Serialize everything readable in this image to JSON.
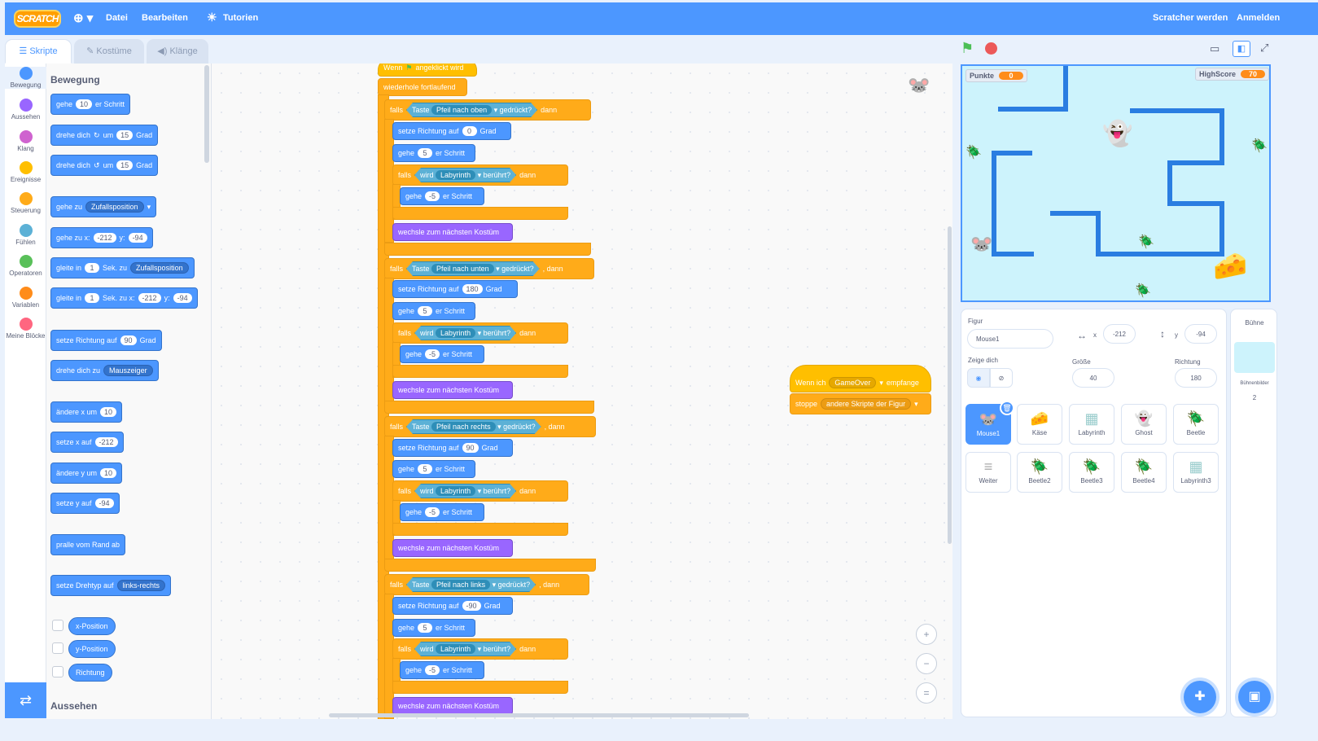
{
  "menubar": {
    "logo": "SCRATCH",
    "globe_icon": "globe-icon",
    "file": "Datei",
    "edit": "Bearbeiten",
    "tutorials": "Tutorien",
    "join": "Scratcher werden",
    "signin": "Anmelden"
  },
  "tabs": {
    "code": "Skripte",
    "costumes": "Kostüme",
    "sounds": "Klänge"
  },
  "categories": [
    {
      "label": "Bewegung",
      "color": "#4c97ff"
    },
    {
      "label": "Aussehen",
      "color": "#9966ff"
    },
    {
      "label": "Klang",
      "color": "#cf63cf"
    },
    {
      "label": "Ereignisse",
      "color": "#ffbf00"
    },
    {
      "label": "Steuerung",
      "color": "#ffab19"
    },
    {
      "label": "Fühlen",
      "color": "#5cb1d6"
    },
    {
      "label": "Operatoren",
      "color": "#59c059"
    },
    {
      "label": "Variablen",
      "color": "#ff8c1a"
    },
    {
      "label": "Meine Blöcke",
      "color": "#ff6680"
    }
  ],
  "palette": {
    "heading_motion": "Bewegung",
    "heading_looks": "Aussehen",
    "b1": {
      "a": "gehe",
      "v": "10",
      "b": "er Schritt"
    },
    "b2": {
      "a": "drehe dich",
      "b": "um",
      "v": "15",
      "c": "Grad"
    },
    "b3": {
      "a": "drehe dich",
      "b": "um",
      "v": "15",
      "c": "Grad"
    },
    "b4": {
      "a": "gehe zu",
      "d": "Zufallsposition"
    },
    "b5": {
      "a": "gehe zu x:",
      "x": "-212",
      "b": "y:",
      "y": "-94"
    },
    "b6": {
      "a": "gleite in",
      "v": "1",
      "b": "Sek. zu",
      "d": "Zufallsposition"
    },
    "b7": {
      "a": "gleite in",
      "v": "1",
      "b": "Sek. zu x:",
      "x": "-212",
      "c": "y:",
      "y": "-94"
    },
    "b8": {
      "a": "setze Richtung auf",
      "v": "90",
      "b": "Grad"
    },
    "b9": {
      "a": "drehe dich zu",
      "d": "Mauszeiger"
    },
    "b10": {
      "a": "ändere x um",
      "v": "10"
    },
    "b11": {
      "a": "setze x auf",
      "v": "-212"
    },
    "b12": {
      "a": "ändere y um",
      "v": "10"
    },
    "b13": {
      "a": "setze y auf",
      "v": "-94"
    },
    "b14": {
      "a": "pralle vom Rand ab"
    },
    "b15": {
      "a": "setze Drehtyp auf",
      "d": "links-rechts"
    },
    "r1": "x-Position",
    "r2": "y-Position",
    "r3": "Richtung"
  },
  "script": {
    "hat": {
      "a": "Wenn",
      "b": "angeklickt wird"
    },
    "forever": "wiederhole fortlaufend",
    "if": "falls",
    "then": "dann",
    "then2": ", dann",
    "key": "Taste",
    "pressed": "gedrückt?",
    "touching_a": "wird",
    "touching_d": "Labyrinth",
    "touching_b": "berührt?",
    "point": "setze Richtung auf",
    "deg": "Grad",
    "move": "gehe",
    "steps": "er Schritt",
    "step_val": "5",
    "back_val": "-5",
    "next_costume": "wechsle zum nächsten Kostüm",
    "k1": "Pfeil nach oben",
    "d1": "0",
    "k2": "Pfeil nach unten",
    "d2": "180",
    "k3": "Pfeil nach rechts",
    "d3": "90",
    "k4": "Pfeil nach links",
    "d4": "-90"
  },
  "script2": {
    "a": "Wenn ich",
    "msg": "GameOver",
    "b": "empfange",
    "stop": "stoppe",
    "stop_opt": "andere Skripte der Figur"
  },
  "stage": {
    "score_label": "Punkte",
    "score": "0",
    "highscore_label": "HighScore",
    "highscore": "70"
  },
  "sprite_info": {
    "label": "Figur",
    "name": "Mouse1",
    "x_label": "x",
    "x": "-212",
    "y_label": "y",
    "y": "-94",
    "show_label": "Zeige dich",
    "size_label": "Größe",
    "size": "40",
    "dir_label": "Richtung",
    "direction": "180"
  },
  "sprites": [
    "Mouse1",
    "Käse",
    "Labyrinth",
    "Ghost",
    "Beetle",
    "Weiter",
    "Beetle2",
    "Beetle3",
    "Beetle4",
    "Labyrinth3"
  ],
  "stage_pane": {
    "title": "Bühne",
    "bg_label": "Bühnenbilder",
    "bg_count": "2"
  }
}
